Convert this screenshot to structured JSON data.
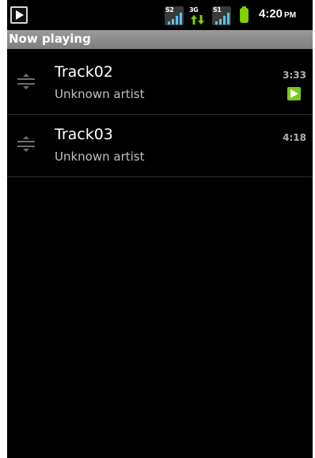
{
  "status_bar": {
    "time": "4:20",
    "ampm": "PM",
    "signal_1_tag": "S2",
    "network_tag": "3G",
    "signal_2_tag": "S1",
    "icons": [
      "play-notification-icon",
      "signal-icon",
      "data-3g-icon",
      "signal-icon",
      "battery-icon"
    ],
    "battery_color": "#7fd000"
  },
  "title_bar": {
    "title": "Now playing"
  },
  "tracks": [
    {
      "title": "Track02",
      "artist": "Unknown artist",
      "duration": "3:33",
      "playing": true
    },
    {
      "title": "Track03",
      "artist": "Unknown artist",
      "duration": "4:18",
      "playing": false
    }
  ],
  "colors": {
    "background": "#000000",
    "title_bar": "#8a8a8a",
    "playing_indicator": "#79c81c"
  }
}
